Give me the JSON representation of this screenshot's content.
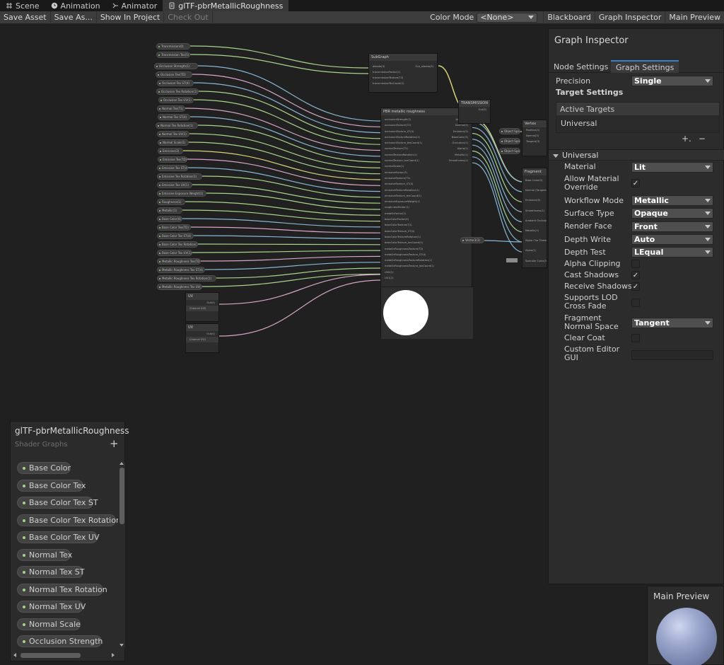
{
  "tabs": [
    {
      "label": "Scene",
      "icon": "grid-icon",
      "active": false
    },
    {
      "label": "Animation",
      "icon": "clock-icon",
      "active": false
    },
    {
      "label": "Animator",
      "icon": "animator-icon",
      "active": false
    },
    {
      "label": "glTF-pbrMetallicRoughness",
      "icon": "shader-graph-icon",
      "active": true
    }
  ],
  "toolbar": {
    "save_asset": "Save Asset",
    "save_as": "Save As...",
    "show_in_project": "Show In Project",
    "check_out": "Check Out",
    "color_mode_label": "Color Mode",
    "color_mode_value": "<None>",
    "blackboard": "Blackboard",
    "graph_inspector": "Graph Inspector",
    "main_preview": "Main Preview"
  },
  "graph": {
    "pills_group1": [
      "Transmission(0)",
      "Transmission Tex(1)",
      "Occlusion Strength(1)",
      "Occlusion Tex(TD)",
      "Occlusion Tex ST(4)",
      "Occlusion Tex Rotation(1)",
      "Occlusion Tex UV(1)",
      "Normal Tex(T1)",
      "Normal Tex ST(4)",
      "Normal Tex Rotation(1)",
      "Normal Tex UV(1)",
      "Normal Scale(1)",
      "Emissive(3)",
      "Emissive Tex(TD)",
      "Emissive Tex ST(4)",
      "Emissive Tex Rotation(1)",
      "Emissive Tex UV(1)"
    ],
    "pills_group2": [
      "Emissive Exposure Weight(1)",
      "Roughness(1)",
      "Metallic(1)",
      "Base Color(4)",
      "Base Color Tex(TD)",
      "Base Color Tex ST(4)",
      "Base Color Tex Rotation(1)",
      "Base Color Tex UV(1)",
      "Metallic Roughness Tex(TD)",
      "Metallic Roughness Tex ST(4)",
      "Metallic Roughness Tex Rotation(1)",
      "Metallic Roughness Tex UV(1)"
    ],
    "main_node": {
      "title": "PBR metallic roughness",
      "inputs": [
        "occlusionStrength(1)",
        "occlusionTexture(T2)",
        "occlusionTexture_ST(4)",
        "occlusionTextureRotation(1)",
        "occlusionTexture_texCoord(1)",
        "normalTexture(T2)",
        "normalTextureRotation(1)",
        "normalTexture_texCoord(1)",
        "normalScale(1)",
        "emissiveFactor(3)",
        "emissiveTexture(T2)",
        "emissiveTexture_ST(4)",
        "emissiveTextureRotation(1)",
        "emissiveTexture_texCoord(1)",
        "emissiveExposureWeight(1)",
        "roughnessFactor(1)",
        "metallicFactor(1)",
        "baseColorFactor(4)",
        "baseColorTexture(T2)",
        "baseColorTexture_ST(4)",
        "baseColorTextureRotation(1)",
        "baseColorTexture_texCoord(1)",
        "metallicRoughnessTexture(T2)",
        "metallicRoughnessTexture_ST(4)",
        "metallicRoughnessTextureRotation(1)",
        "metallicRoughnessTexture_texCoord(1)",
        "UV0(2)",
        "UV1(2)"
      ],
      "outputs": [
        "Albedo(3)",
        "Normal(3)",
        "Emission(3)",
        "BaseColor(3)",
        "Occlusion(1)",
        "Alpha(1)",
        "Metallic(1)",
        "Smoothness(1)"
      ]
    },
    "subgraph_node": {
      "title": "SubGraph",
      "inputs": [
        "albedo(3)",
        "transmissionFactor(1)",
        "transmissionTexture(T2)",
        "transmissionTexCoord(1)"
      ],
      "output": "Out_albedo(3)"
    },
    "transmission_node": {
      "title": "TRANSMISSION",
      "output": "Out(3)"
    },
    "vertex_node": {
      "title": "Vertex",
      "tags": [
        "Object Space",
        "Object Space",
        "Object Space"
      ],
      "rows": [
        "Position(3)",
        "Normal(3)",
        "Tangent(3)"
      ]
    },
    "fragment_node": {
      "title": "Fragment",
      "rows": [
        "Base Color(3)",
        "Normal (Tangent Space)(3)",
        "Emission(3)",
        "Smoothness(1)",
        "Ambient Occlusion(1)",
        "Metallic(1)",
        "Alpha Clip Threshold(1)",
        "Alpha(1)",
        "Specular Color(3)"
      ],
      "extra_tag": "Vector3(3)"
    },
    "uv_nodes": [
      {
        "title": "UV",
        "output": "Out(4)",
        "channel": "Channel UV0"
      },
      {
        "title": "UV",
        "output": "Out(4)",
        "channel": "Channel UV1"
      }
    ]
  },
  "blackboard": {
    "title": "glTF-pbrMetallicRoughness",
    "subtitle": "Shader Graphs",
    "add": "+",
    "items": [
      "Base Color",
      "Base Color Tex",
      "Base Color Tex ST",
      "Base Color Tex Rotation",
      "Base Color Tex UV",
      "Normal Tex",
      "Normal Tex ST",
      "Normal Tex Rotation",
      "Normal Tex UV",
      "Normal Scale",
      "Occlusion Strength"
    ]
  },
  "inspector": {
    "title": "Graph Inspector",
    "tabs": [
      "Node Settings",
      "Graph Settings"
    ],
    "active_tab": "Graph Settings",
    "precision_label": "Precision",
    "precision_value": "Single",
    "target_settings": "Target Settings",
    "active_targets": "Active Targets",
    "target_item": "Universal",
    "add_btn": "+.",
    "remove_btn": "−",
    "section": "Universal",
    "props": {
      "material": {
        "label": "Material",
        "value": "Lit"
      },
      "allow_override": {
        "label": "Allow Material Override",
        "checked": true
      },
      "workflow": {
        "label": "Workflow Mode",
        "value": "Metallic"
      },
      "surface": {
        "label": "Surface Type",
        "value": "Opaque"
      },
      "render_face": {
        "label": "Render Face",
        "value": "Front"
      },
      "depth_write": {
        "label": "Depth Write",
        "value": "Auto"
      },
      "depth_test": {
        "label": "Depth Test",
        "value": "LEqual"
      },
      "alpha_clipping": {
        "label": "Alpha Clipping",
        "checked": false
      },
      "cast_shadows": {
        "label": "Cast Shadows",
        "checked": true
      },
      "receive_shadows": {
        "label": "Receive Shadows",
        "checked": true
      },
      "lod_crossfade": {
        "label": "Supports LOD Cross Fade",
        "checked": false
      },
      "fragment_normal": {
        "label": "Fragment Normal Space",
        "value": "Tangent"
      },
      "clear_coat": {
        "label": "Clear Coat",
        "checked": false
      },
      "custom_editor": {
        "label": "Custom Editor GUI",
        "value": ""
      }
    },
    "checkmark": "✓"
  },
  "main_preview": {
    "title": "Main Preview"
  },
  "colors": {
    "wire_color": "#86b6d2",
    "wire_pink": "#d6a6c6",
    "wire_green": "#a8d48a",
    "wire_yellow": "#d8d27a",
    "accent": "#3d7fc6",
    "property_dot": "#9fd68c"
  }
}
